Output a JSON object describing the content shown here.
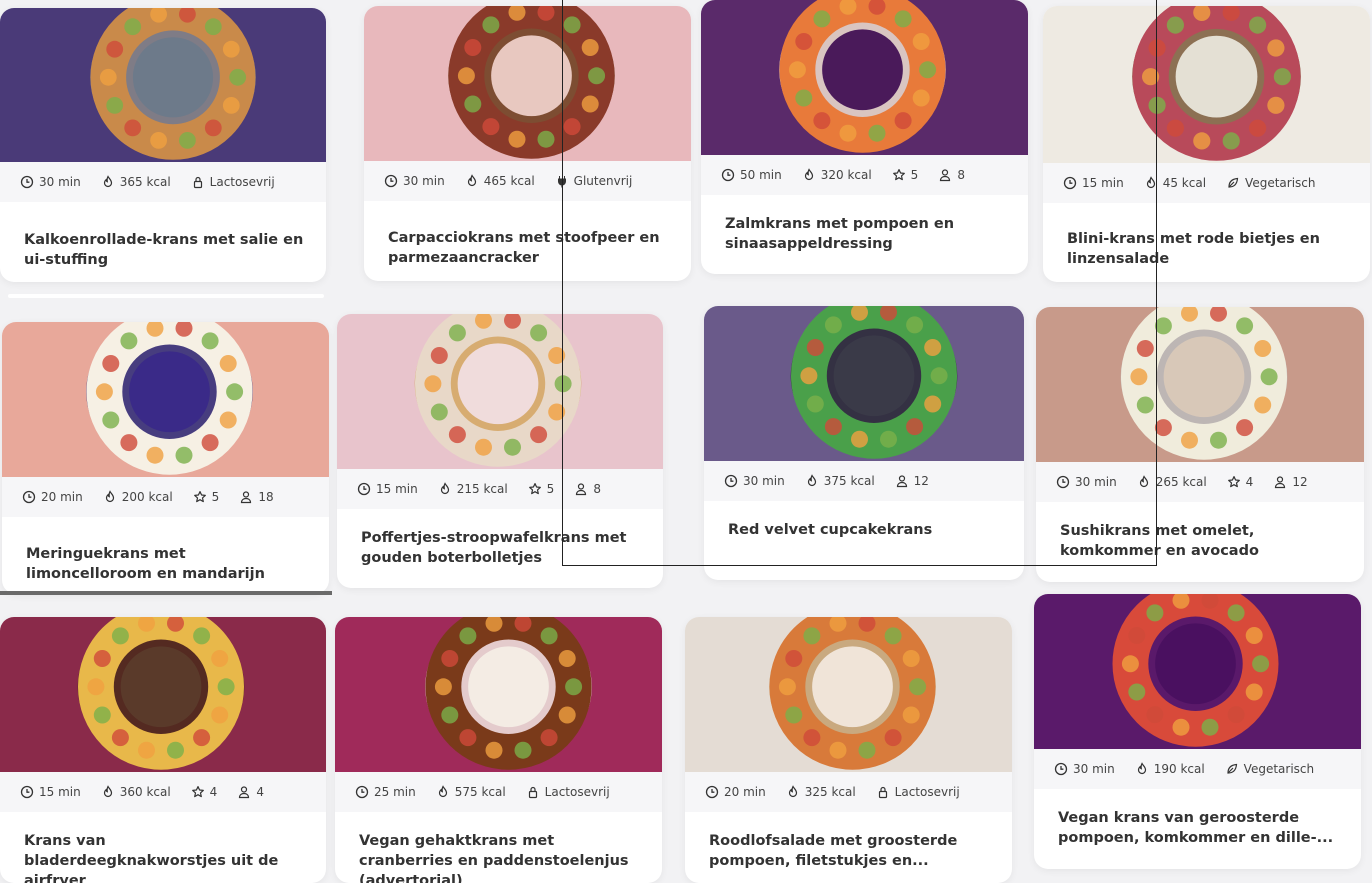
{
  "cards": [
    {
      "title": "Kalkoenrollade-krans met salie en ui-stuffing",
      "meta": [
        {
          "icon": "clock-icon",
          "text": "30 min"
        },
        {
          "icon": "flame-icon",
          "text": "365 kcal"
        },
        {
          "icon": "lock-icon",
          "text": "Lactosevrij"
        }
      ],
      "bg": "#4a3a78",
      "ring": "#c98a4a",
      "center": "#6d7a8a",
      "dish": "#888"
    },
    {
      "title": "Carpacciokrans met stoofpeer en parmezaancracker",
      "meta": [
        {
          "icon": "clock-icon",
          "text": "30 min"
        },
        {
          "icon": "flame-icon",
          "text": "465 kcal"
        },
        {
          "icon": "plug-icon",
          "text": "Glutenvrij"
        }
      ],
      "bg": "#e8b8bc",
      "ring": "#8a3a2a",
      "center": "#e8c8c0",
      "dish": "#6a3a1a"
    },
    {
      "title": "Zalmkrans met pompoen en sinaasappeldressing",
      "meta": [
        {
          "icon": "clock-icon",
          "text": "50 min"
        },
        {
          "icon": "flame-icon",
          "text": "320 kcal"
        },
        {
          "icon": "star-icon",
          "text": "5"
        },
        {
          "icon": "person-icon",
          "text": "8"
        }
      ],
      "bg": "#5a2a6a",
      "ring": "#e87a3a",
      "center": "#4a1a5a",
      "dish": "#f0e0d0"
    },
    {
      "title": "Blini-krans met rode bietjes en linzensalade",
      "meta": [
        {
          "icon": "clock-icon",
          "text": "15 min"
        },
        {
          "icon": "flame-icon",
          "text": "45 kcal"
        },
        {
          "icon": "leaf-icon",
          "text": "Vegetarisch"
        }
      ],
      "bg": "#eeeae2",
      "ring": "#b84a5a",
      "center": "#e4e0d4",
      "dish": "#7a5a3a"
    },
    {
      "title": "Meringuekrans met limoncelloroom en mandarijn",
      "meta": [
        {
          "icon": "clock-icon",
          "text": "20 min"
        },
        {
          "icon": "flame-icon",
          "text": "200 kcal"
        },
        {
          "icon": "star-icon",
          "text": "5"
        },
        {
          "icon": "person-icon",
          "text": "18"
        }
      ],
      "bg": "#e8a89a",
      "ring": "#f6f0e4",
      "center": "#3a2a88",
      "dish": "#2a2a7a"
    },
    {
      "title": "Poffertjes-stroopwafelkrans met gouden boterbolletjes",
      "meta": [
        {
          "icon": "clock-icon",
          "text": "15 min"
        },
        {
          "icon": "flame-icon",
          "text": "215 kcal"
        },
        {
          "icon": "star-icon",
          "text": "5"
        },
        {
          "icon": "person-icon",
          "text": "8"
        }
      ],
      "bg": "#e8c4cc",
      "ring": "#e8d8c8",
      "center": "#f0dcdc",
      "dish": "#d4a860"
    },
    {
      "title": "Red velvet cupcakekrans",
      "meta": [
        {
          "icon": "clock-icon",
          "text": "30 min"
        },
        {
          "icon": "flame-icon",
          "text": "375 kcal"
        },
        {
          "icon": "person-icon",
          "text": "12"
        }
      ],
      "bg": "#6a5a8a",
      "ring": "#4aa04a",
      "center": "#3a3a48",
      "dish": "#2a2a36"
    },
    {
      "title": "Sushikrans met omelet, komkommer en avocado",
      "meta": [
        {
          "icon": "clock-icon",
          "text": "30 min"
        },
        {
          "icon": "flame-icon",
          "text": "265 kcal"
        },
        {
          "icon": "star-icon",
          "text": "4"
        },
        {
          "icon": "person-icon",
          "text": "12"
        }
      ],
      "bg": "#c89a8a",
      "ring": "#f0ecdc",
      "center": "#d8c8b8",
      "dish": "#bbbbbb"
    },
    {
      "title": "Krans van bladerdeegknakworstjes uit de airfryer",
      "meta": [
        {
          "icon": "clock-icon",
          "text": "15 min"
        },
        {
          "icon": "flame-icon",
          "text": "360 kcal"
        },
        {
          "icon": "star-icon",
          "text": "4"
        },
        {
          "icon": "person-icon",
          "text": "4"
        }
      ],
      "bg": "#8a2a4a",
      "ring": "#e8b84a",
      "center": "#5a3a2a",
      "dish": "#4a2a1a"
    },
    {
      "title": "Vegan gehaktkrans met cranberries en paddenstoelenjus (advertorial)",
      "meta": [
        {
          "icon": "clock-icon",
          "text": "25 min"
        },
        {
          "icon": "flame-icon",
          "text": "575 kcal"
        },
        {
          "icon": "lock-icon",
          "text": "Lactosevrij"
        }
      ],
      "bg": "#a02a5a",
      "ring": "#7a3a1a",
      "center": "#f4ece4",
      "dish": "#f0e8e0"
    },
    {
      "title": "Roodlofsalade met groosterde pompoen, filetstukjes en...",
      "meta": [
        {
          "icon": "clock-icon",
          "text": "20 min"
        },
        {
          "icon": "flame-icon",
          "text": "325 kcal"
        },
        {
          "icon": "lock-icon",
          "text": "Lactosevrij"
        }
      ],
      "bg": "#e4dcd4",
      "ring": "#d87a3a",
      "center": "#f0e4d8",
      "dish": "#c4a070"
    },
    {
      "title": "Vegan krans van geroosterde pompoen, komkommer en dille-...",
      "meta": [
        {
          "icon": "clock-icon",
          "text": "30 min"
        },
        {
          "icon": "flame-icon",
          "text": "190 kcal"
        },
        {
          "icon": "leaf-icon",
          "text": "Vegetarisch"
        }
      ],
      "bg": "#5a1a6a",
      "ring": "#d84a3a",
      "center": "#4a1060",
      "dish": "#5a1a6a"
    }
  ]
}
